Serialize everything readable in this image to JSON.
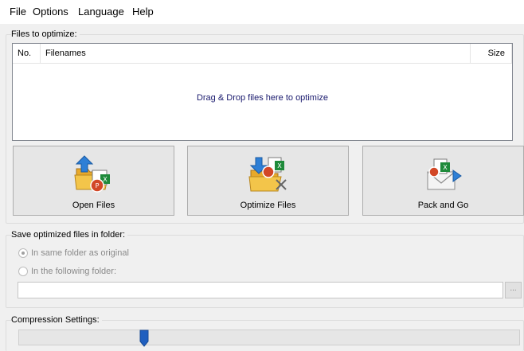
{
  "menu": {
    "file": "File",
    "options": "Options",
    "language": "Language",
    "help": "Help"
  },
  "files_group": {
    "title": "Files to optimize:",
    "columns": {
      "no": "No.",
      "filenames": "Filenames",
      "size": "Size"
    },
    "drop_hint": "Drag & Drop files here to optimize"
  },
  "buttons": {
    "open_files": "Open Files",
    "optimize_files": "Optimize Files",
    "pack_and_go": "Pack and Go",
    "browse": "..."
  },
  "save_group": {
    "title": "Save optimized files in folder:",
    "option_same": "In same folder as original",
    "option_following": "In the following folder:",
    "selected": "option_same",
    "folder_path": ""
  },
  "compression_group": {
    "title": "Compression Settings:",
    "level_fraction": 0.25
  },
  "colors": {
    "accent_blue": "#1f5fbf",
    "drop_hint": "#1a1a6e",
    "folder_yellow": "#f3c54a",
    "excel_green": "#1e8a3a",
    "powerpoint_red": "#d24726"
  },
  "icons": {
    "open_files": "open-folder-icon",
    "optimize_files": "optimize-folder-icon",
    "pack_and_go": "envelope-pack-icon"
  }
}
